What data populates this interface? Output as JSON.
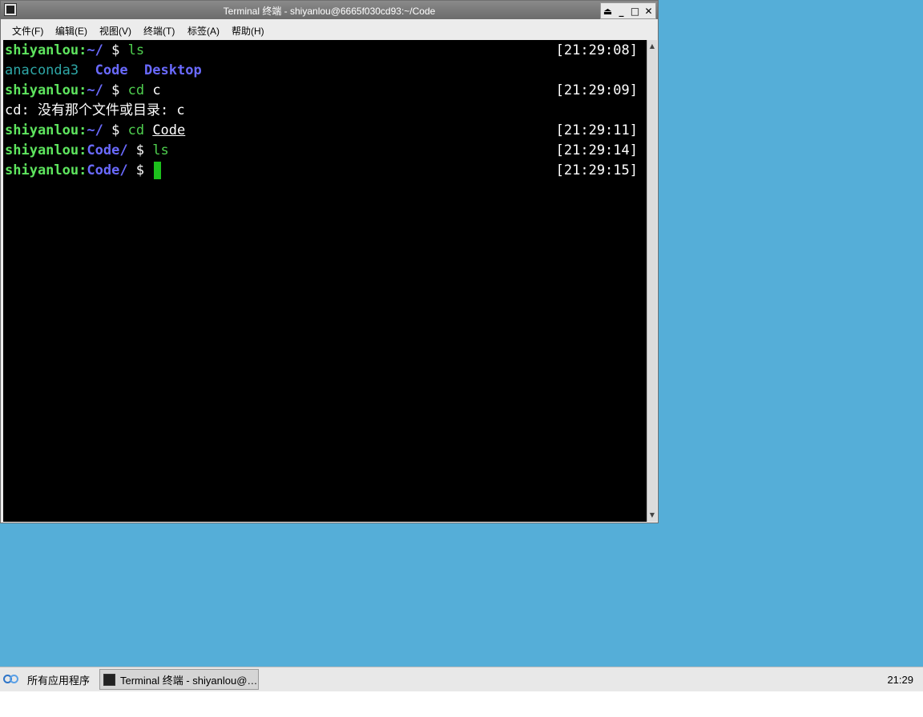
{
  "window": {
    "title": "Terminal 终端 - shiyanlou@6665f030cd93:~/Code",
    "controls": {
      "shade": "⏏",
      "minimize": "_",
      "maximize": "□",
      "close": "✕"
    }
  },
  "menu": {
    "items": [
      "文件(F)",
      "编辑(E)",
      "视图(V)",
      "终端(T)",
      "标签(A)",
      "帮助(H)"
    ]
  },
  "terminal": {
    "lines": [
      {
        "user": "shiyanlou",
        "path": "~/",
        "prompt": " $ ",
        "cmd": "ls",
        "args": "",
        "time": "[21:29:08]"
      },
      {
        "output": {
          "item1": "anaconda3",
          "item2": "Code",
          "item3": "Desktop"
        }
      },
      {
        "user": "shiyanlou",
        "path": "~/",
        "prompt": " $ ",
        "cmd": "cd",
        "args": "c",
        "time": "[21:29:09]"
      },
      {
        "error": "cd: 没有那个文件或目录: c"
      },
      {
        "user": "shiyanlou",
        "path": "~/",
        "prompt": " $ ",
        "cmd": "cd",
        "args": "Code",
        "time": "[21:29:11]"
      },
      {
        "user": "shiyanlou",
        "path": "Code/",
        "prompt": " $ ",
        "cmd": "ls",
        "args": "",
        "time": "[21:29:14]"
      },
      {
        "user": "shiyanlou",
        "path": "Code/",
        "prompt": " $ ",
        "cmd": "",
        "args": "",
        "time": "[21:29:15]"
      }
    ],
    "colon": ":"
  },
  "taskbar": {
    "start_label": "所有应用程序",
    "task_label": "Terminal 终端 - shiyanlou@…",
    "clock": "21:29"
  },
  "colors": {
    "desktop": "#55aed8",
    "prompt_user": "#5ee55e",
    "prompt_path": "#6a6aff",
    "cursor": "#1cc01c"
  }
}
